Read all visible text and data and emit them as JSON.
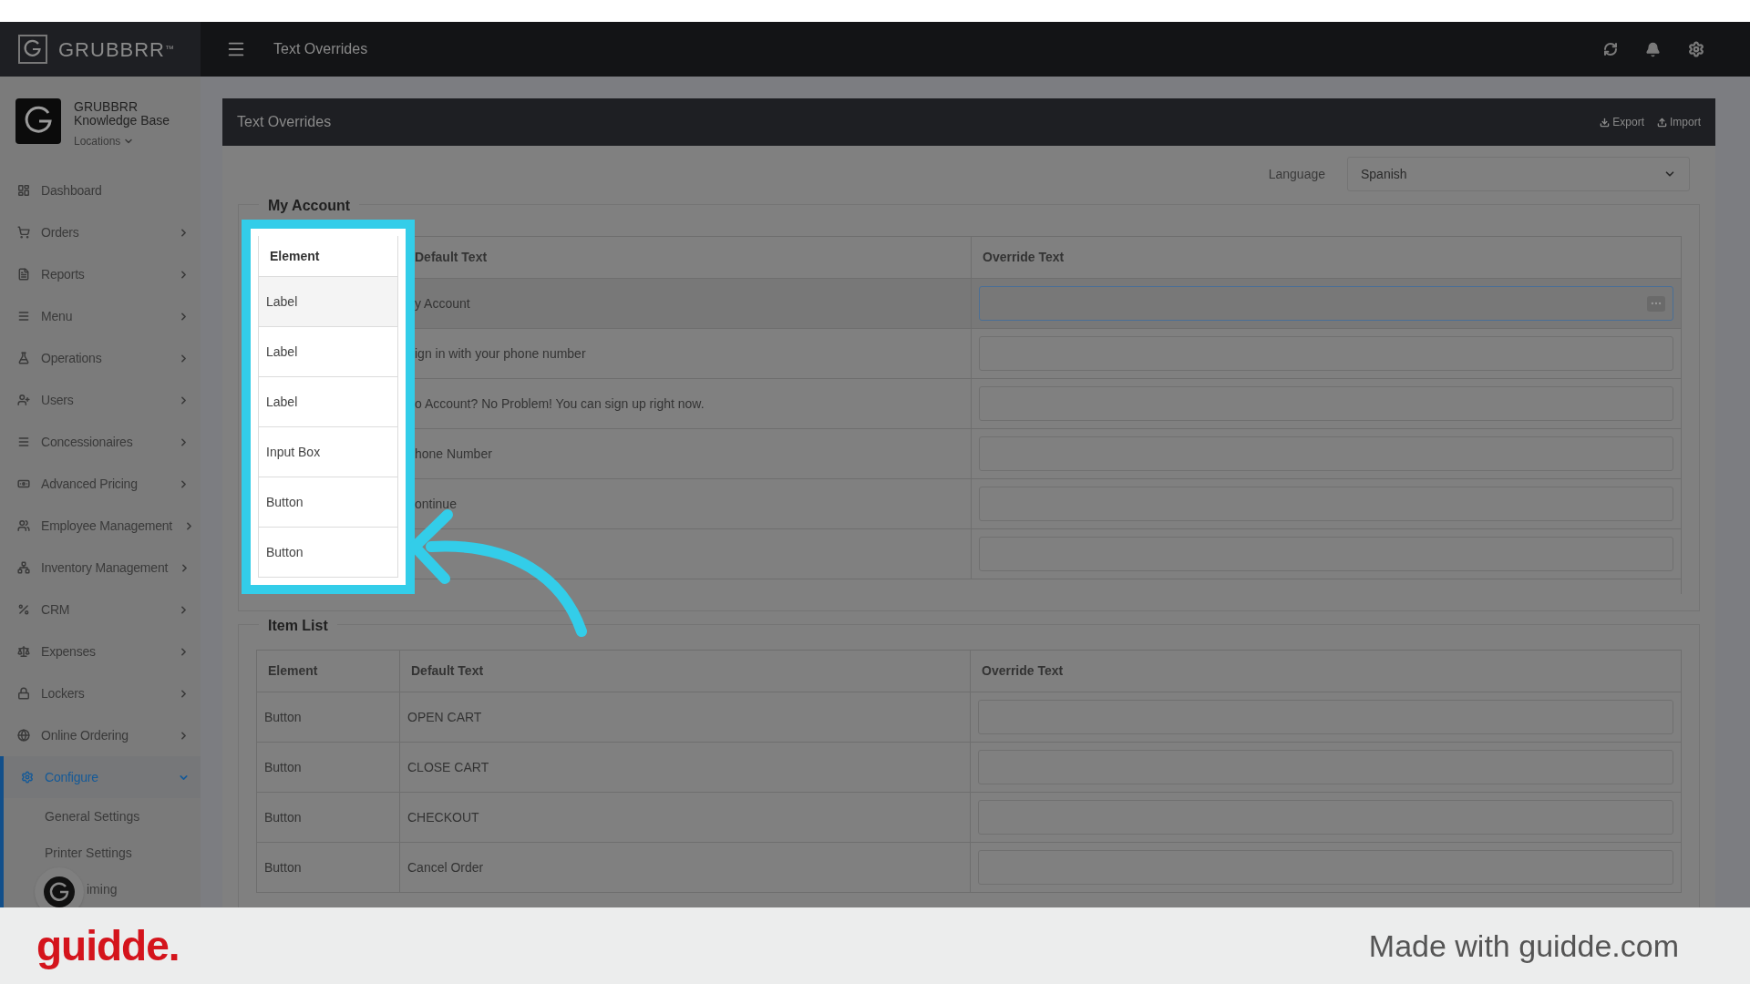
{
  "top_bar": {
    "logo": "GRUBBRR",
    "trademark": "™",
    "title": "Text Overrides"
  },
  "account": {
    "name_lines": [
      "GRUBBRR",
      "Knowledge Base"
    ],
    "locations": "Locations"
  },
  "sidebar": {
    "items": [
      {
        "label": "Dashboard",
        "kind": "link",
        "selected": false
      },
      {
        "label": "Orders",
        "kind": "group",
        "selected": false,
        "expanded": false
      },
      {
        "label": "Reports",
        "kind": "group",
        "selected": false,
        "expanded": false
      },
      {
        "label": "Menu",
        "kind": "group",
        "selected": false,
        "expanded": false
      },
      {
        "label": "Operations",
        "kind": "group",
        "selected": false,
        "expanded": false
      },
      {
        "label": "Users",
        "kind": "group",
        "selected": false,
        "expanded": false
      },
      {
        "label": "Concessionaires",
        "kind": "group",
        "selected": false,
        "expanded": false
      },
      {
        "label": "Advanced Pricing",
        "kind": "group",
        "selected": false,
        "expanded": false
      },
      {
        "label": "Employee Management",
        "kind": "group",
        "selected": false,
        "expanded": false
      },
      {
        "label": "Inventory Management",
        "kind": "group",
        "selected": false,
        "expanded": false
      },
      {
        "label": "CRM",
        "kind": "group",
        "selected": false,
        "expanded": false
      },
      {
        "label": "Expenses",
        "kind": "group",
        "selected": false,
        "expanded": false
      },
      {
        "label": "Lockers",
        "kind": "group",
        "selected": false,
        "expanded": false
      },
      {
        "label": "Online Ordering",
        "kind": "group",
        "selected": false,
        "expanded": false
      },
      {
        "label": "Configure",
        "kind": "group",
        "selected": true,
        "expanded": true,
        "children": [
          {
            "label": "General Settings"
          },
          {
            "label": "Printer Settings"
          },
          {
            "label": "iming"
          }
        ]
      }
    ]
  },
  "panel": {
    "title": "Text Overrides",
    "actions": [
      "Export",
      "Import"
    ],
    "language_label": "Language",
    "language": "Spanish",
    "sections": [
      {
        "title": "My Account",
        "highlighted": true,
        "columns": [
          "Element",
          "Default Text",
          "Override Text"
        ],
        "rows": [
          {
            "element": "Label",
            "default": "y Account",
            "focused": true
          },
          {
            "element": "Label",
            "default": "ign in with your phone number",
            "focused": false
          },
          {
            "element": "Label",
            "default": "o Account? No Problem! You can sign up right now.",
            "focused": false
          },
          {
            "element": "Input Box",
            "default": "hone Number",
            "focused": false
          },
          {
            "element": "Button",
            "default": "ontinue",
            "focused": false
          },
          {
            "element": "Button",
            "focused": false
          }
        ]
      },
      {
        "title": "Item List",
        "highlighted": false,
        "columns": [
          "Element",
          "Default Text",
          "Override Text"
        ],
        "rows": [
          {
            "element": "Button",
            "default": "OPEN CART",
            "focused": false
          },
          {
            "element": "Button",
            "default": "CLOSE CART",
            "focused": false
          },
          {
            "element": "Button",
            "default": "CHECKOUT",
            "focused": false
          },
          {
            "element": "Button",
            "default": "Cancel Order",
            "focused": false
          }
        ]
      }
    ]
  },
  "footer": {
    "brand": "guidde.",
    "credit": "Made with guidde.com"
  }
}
